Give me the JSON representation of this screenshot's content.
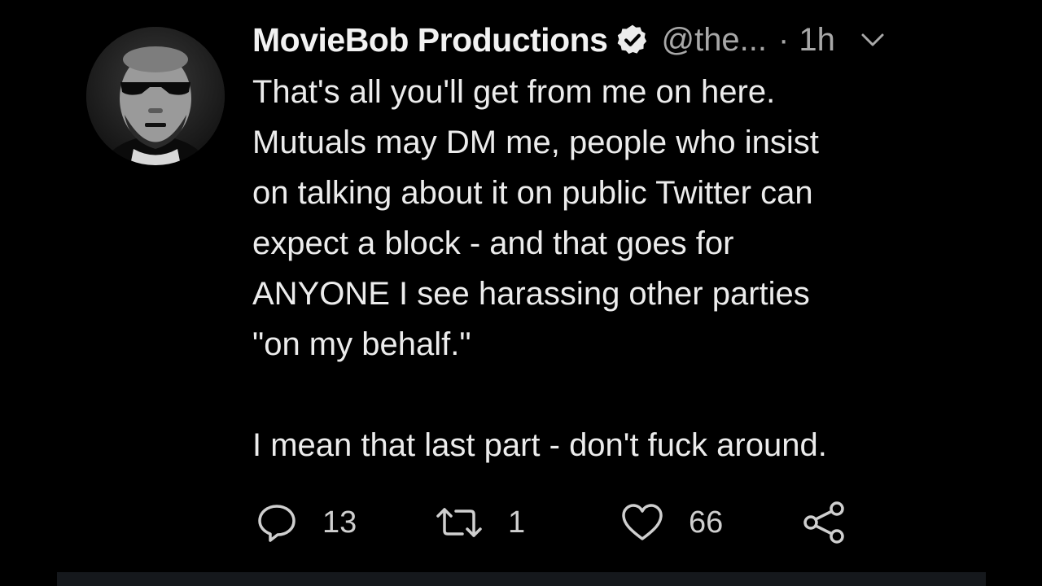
{
  "tweet": {
    "display_name": "MovieBob Productions",
    "handle": "@the...",
    "separator": "·",
    "time": "1h",
    "body_paragraph_1": "That's all you'll get from me on here.\nMutuals may DM me, people who insist\non talking about it on public Twitter can\nexpect a block - and that goes for\nANYONE I see harassing other parties\n\"on my behalf.\"",
    "body_paragraph_2": "I mean that last part - don't fuck around.",
    "counts": {
      "replies": "13",
      "retweets": "1",
      "likes": "66"
    }
  },
  "icons": {
    "verified": "verified-badge-icon",
    "menu": "chevron-down-icon",
    "reply": "reply-icon",
    "retweet": "retweet-icon",
    "like": "heart-icon",
    "share": "share-icon"
  },
  "colors": {
    "background": "#000000",
    "text": "#ececec",
    "secondary": "#a8a8a8",
    "bottom_bar": "#15181c"
  }
}
